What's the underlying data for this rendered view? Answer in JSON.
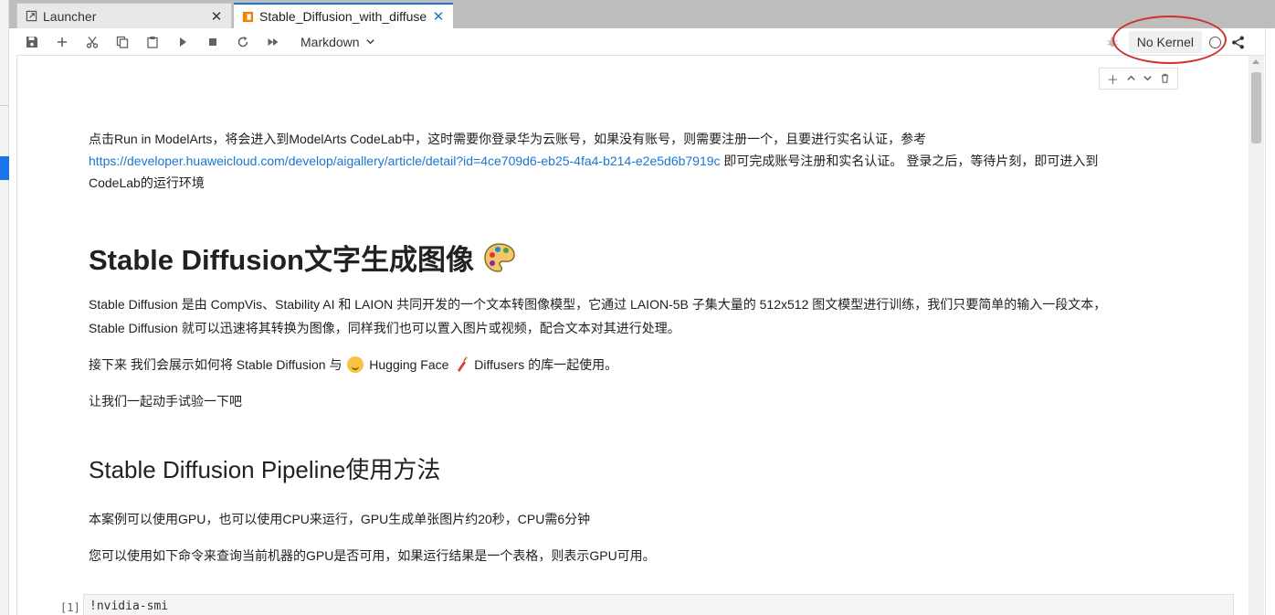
{
  "tabs": [
    {
      "label": "Launcher",
      "icon": "launcher-icon",
      "active": false
    },
    {
      "label": "Stable_Diffusion_with_diffuse",
      "icon": "notebook-icon",
      "active": true
    }
  ],
  "toolbar": {
    "cell_type": "Markdown",
    "kernel_name": "No Kernel",
    "buttons": [
      "save-icon",
      "add-cell-icon",
      "cut-icon",
      "copy-icon",
      "paste-icon",
      "run-icon",
      "stop-icon",
      "restart-icon",
      "run-all-icon"
    ]
  },
  "content": {
    "intro_line1": "点击Run in ModelArts，将会进入到ModelArts CodeLab中，这时需要你登录华为云账号，如果没有账号，则需要注册一个，且要进行实名认证，参考",
    "intro_link": "https://developer.huaweicloud.com/develop/aigallery/article/detail?id=4ce709d6-eb25-4fa4-b214-e2e5d6b7919c",
    "intro_line2_suffix": " 即可完成账号注册和实名认证。 登录之后，等待片刻，即可进入到",
    "intro_line3": "CodeLab的运行环境",
    "heading1": "Stable Diffusion文字生成图像",
    "desc_line1": "Stable Diffusion 是由 CompVis、Stability AI 和 LAION 共同开发的一个文本转图像模型，它通过 LAION-5B 子集大量的 512x512 图文模型进行训练，我们只要简单的输入一段文本，",
    "desc_line2": "Stable Diffusion 就可以迅速将其转换为图像，同样我们也可以置入图片或视频，配合文本对其进行处理。",
    "next_prefix": "接下来 我们会展示如何将 Stable Diffusion 与",
    "next_hf": "Hugging Face",
    "next_suffix": "Diffusers 的库一起使用。",
    "try_line": "让我们一起动手试验一下吧",
    "heading2": "Stable Diffusion Pipeline使用方法",
    "gpu_line": "本案例可以使用GPU，也可以使用CPU来运行，GPU生成单张图片约20秒，CPU需6分钟",
    "check_line": "您可以使用如下命令来查询当前机器的GPU是否可用，如果运行结果是一个表格，则表示GPU可用。"
  },
  "code_cell": {
    "prompt": "[1]",
    "code": "!nvidia-smi"
  },
  "colors": {
    "accent": "#1976d2",
    "annotation": "#d32f2f"
  }
}
